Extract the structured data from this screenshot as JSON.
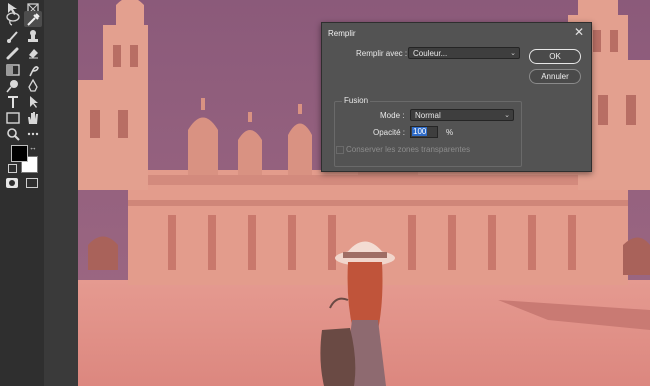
{
  "dialog": {
    "title": "Remplir",
    "close_glyph": "✕",
    "fill_label": "Remplir avec :",
    "fill_value": "Couleur...",
    "ok_label": "OK",
    "cancel_label": "Annuler",
    "fusion_title": "Fusion",
    "mode_label": "Mode :",
    "mode_value": "Normal",
    "opacity_label": "Opacité :",
    "opacity_value": "100",
    "opacity_unit": "%",
    "preserve_label": "Conserver les zones transparentes",
    "preserve_checked": false
  },
  "toolbar": {
    "tools": [
      "move-tool",
      "artboard-tool",
      "lasso-tool",
      "eyedropper-tool",
      "brush-tool",
      "stamp-tool",
      "healing-tool",
      "eraser-tool",
      "gradient-tool",
      "smudge-tool",
      "dodge-tool",
      "pen-tool",
      "type-tool",
      "path-select-tool",
      "shape-tool",
      "hand-tool",
      "zoom-tool",
      "more-tools"
    ],
    "foreground_color": "#000000",
    "background_color": "#ffffff"
  },
  "canvas": {
    "overlay_color": "#e8817b",
    "subject": "photo-overlay"
  },
  "colors": {
    "dialog_bg": "#535353",
    "toolbar_bg": "#2f2f2f",
    "accent_selection": "#2f6cc9"
  }
}
